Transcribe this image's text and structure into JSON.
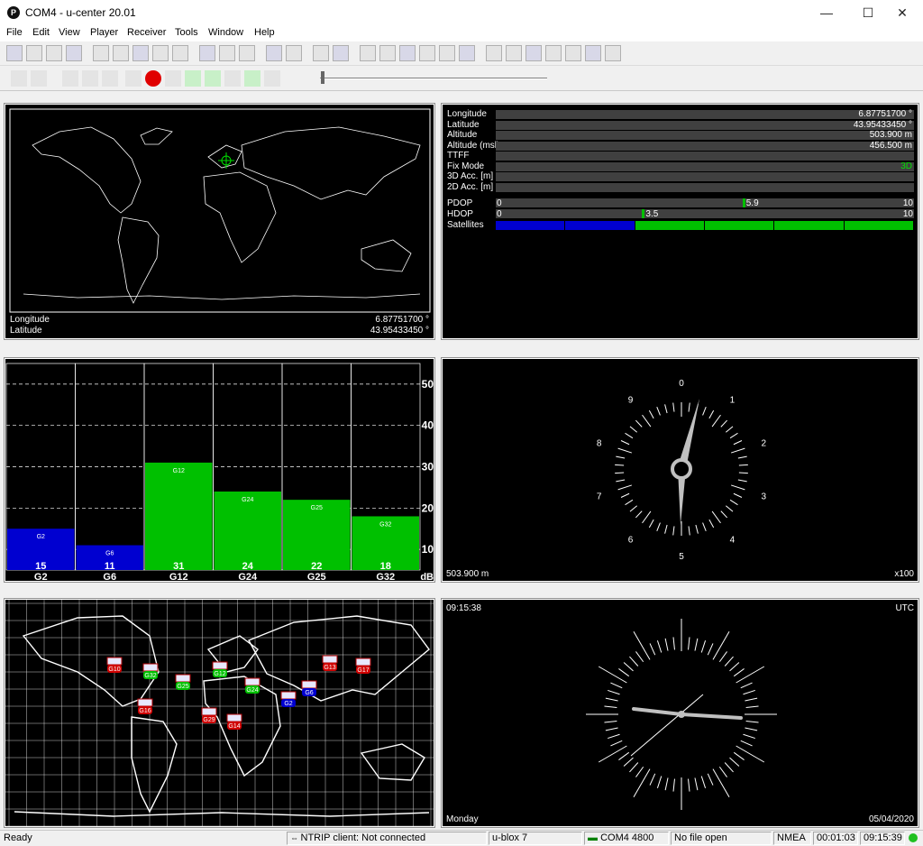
{
  "window": {
    "title": "COM4 - u-center 20.01",
    "app_icon_letter": "P",
    "minimize": "—",
    "maximize": "☐",
    "close": "✕"
  },
  "menu": [
    "File",
    "Edit",
    "View",
    "Player",
    "Receiver",
    "Tools",
    "Window",
    "Help"
  ],
  "colors": {
    "green": "#00c000",
    "blue": "#0000d0",
    "bar_bg": "#404040"
  },
  "world_view": {
    "longitude_label": "Longitude",
    "longitude_value": "6.87751700 °",
    "latitude_label": "Latitude",
    "latitude_value": "43.95433450 °"
  },
  "data_view": {
    "rows": [
      {
        "label": "Longitude",
        "value": "6.87751700 °"
      },
      {
        "label": "Latitude",
        "value": "43.95433450 °"
      },
      {
        "label": "Altitude",
        "value": "503.900 m"
      },
      {
        "label": "Altitude (msl)",
        "value": "456.500 m"
      },
      {
        "label": "TTFF",
        "value": ""
      },
      {
        "label": "Fix Mode",
        "value": "3D"
      },
      {
        "label": "3D Acc. [m]",
        "value": ""
      },
      {
        "label": "2D Acc. [m]",
        "value": ""
      }
    ],
    "pdop": {
      "label": "PDOP",
      "min": "0",
      "value": "5.9",
      "max": "10",
      "level": 0.59
    },
    "hdop": {
      "label": "HDOP",
      "min": "0",
      "value": "3.5",
      "max": "10",
      "level": 0.35
    },
    "satellites_label": "Satellites",
    "satellite_segments": [
      "blue",
      "blue",
      "green",
      "green",
      "green",
      "green"
    ]
  },
  "chart_data": {
    "type": "bar",
    "categories": [
      "G2",
      "G6",
      "G12",
      "G24",
      "G25",
      "G32"
    ],
    "values": [
      15,
      11,
      31,
      24,
      22,
      18
    ],
    "bar_colors": [
      "blue",
      "blue",
      "green",
      "green",
      "green",
      "green"
    ],
    "inner_labels": [
      "G2",
      "G6",
      "G12",
      "G24",
      "G25",
      "G32"
    ],
    "yticks": [
      "10",
      "20",
      "30",
      "40",
      "50"
    ],
    "unit": "dB",
    "ylim": [
      5,
      55
    ]
  },
  "altimeter": {
    "numbers": [
      "0",
      "1",
      "2",
      "3",
      "4",
      "5",
      "6",
      "7",
      "8",
      "9"
    ],
    "altitude": "503.900 m",
    "multiplier": "x100"
  },
  "clock": {
    "time": "09:15:38",
    "zone": "UTC",
    "day": "Monday",
    "date": "05/04/2020"
  },
  "sky_sats": [
    {
      "id": "G10",
      "color": "red"
    },
    {
      "id": "G32",
      "color": "green"
    },
    {
      "id": "G25",
      "color": "green"
    },
    {
      "id": "G12",
      "color": "green"
    },
    {
      "id": "G24",
      "color": "green"
    },
    {
      "id": "G2",
      "color": "blue"
    },
    {
      "id": "G6",
      "color": "blue"
    },
    {
      "id": "G13",
      "color": "red"
    },
    {
      "id": "G17",
      "color": "red"
    },
    {
      "id": "G16",
      "color": "red"
    },
    {
      "id": "G29",
      "color": "red"
    },
    {
      "id": "G14",
      "color": "red"
    }
  ],
  "statusbar": {
    "ready": "Ready",
    "ntrip": "NTRIP client: Not connected",
    "receiver": "u-blox 7",
    "port": "COM4 4800",
    "file": "No file open",
    "protocol": "NMEA",
    "elapsed": "00:01:03",
    "clock": "09:15:39"
  }
}
